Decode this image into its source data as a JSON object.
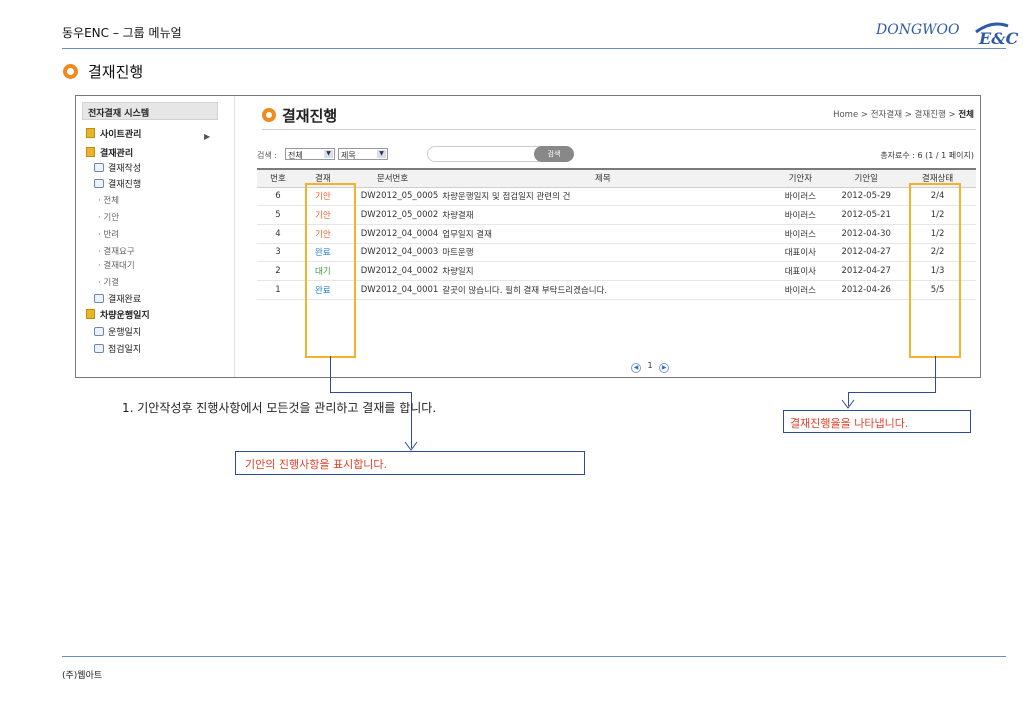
{
  "header": {
    "title": "동우ENC – 그룹 메뉴얼",
    "logo_main": "DONGWOO",
    "logo_sub": "E&C"
  },
  "section_title": "결재진행",
  "sidebar": {
    "head": "전자결재 시스템",
    "items": [
      {
        "label": "사이트관리"
      },
      {
        "label": "결재관리"
      },
      {
        "label": "결재작성"
      },
      {
        "label": "결재진행"
      },
      {
        "label": "· 전체"
      },
      {
        "label": "· 기안"
      },
      {
        "label": "· 반려"
      },
      {
        "label": "· 결재요구"
      },
      {
        "label": "· 결재대기"
      },
      {
        "label": "· 기결"
      },
      {
        "label": "결재완료"
      },
      {
        "label": "차량운행일지"
      },
      {
        "label": "운행일지"
      },
      {
        "label": "점검일지"
      }
    ]
  },
  "content": {
    "title": "결재진행",
    "breadcrumb": {
      "home": "Home",
      "a": "전자결재",
      "b": "결재진행",
      "c": "전체"
    },
    "search": {
      "label": "검색 :",
      "sel1": "전체",
      "sel2": "제목",
      "button": "검색"
    },
    "total": "총자료수 : 6 (1 / 1 페이지)",
    "columns": [
      "번호",
      "결재",
      "문서번호",
      "제목",
      "기안자",
      "기안일",
      "결재상태"
    ],
    "rows": [
      {
        "no": "6",
        "status": "기안",
        "doc": "DW2012_05_0005",
        "title": "차량운행일지 및 점검일지 관련의 건",
        "drafter": "바이러스",
        "date": "2012-05-29",
        "progress": "2/4"
      },
      {
        "no": "5",
        "status": "기안",
        "doc": "DW2012_05_0002",
        "title": "차량결재",
        "drafter": "바이러스",
        "date": "2012-05-21",
        "progress": "1/2"
      },
      {
        "no": "4",
        "status": "기안",
        "doc": "DW2012_04_0004",
        "title": "업무일지 결재",
        "drafter": "바이러스",
        "date": "2012-04-30",
        "progress": "1/2"
      },
      {
        "no": "3",
        "status": "완료",
        "doc": "DW2012_04_0003",
        "title": "마트운행",
        "drafter": "대표이사",
        "date": "2012-04-27",
        "progress": "2/2"
      },
      {
        "no": "2",
        "status": "대기",
        "doc": "DW2012_04_0002",
        "title": "차량일지",
        "drafter": "대표이사",
        "date": "2012-04-27",
        "progress": "1/3"
      },
      {
        "no": "1",
        "status": "완료",
        "doc": "DW2012_04_0001",
        "title": "갈곳이 많습니다. 필히 결재 부탁드리겠습니다.",
        "drafter": "바이러스",
        "date": "2012-04-26",
        "progress": "5/5"
      }
    ],
    "status_colors": {
      "기안": "#e8632a",
      "완료": "#2a7fd0",
      "대기": "#2f9a3c"
    },
    "pager": "1"
  },
  "annotations": {
    "note1": "1.  기안작성후  진행사항에서 모든것을 관리하고 결재를 합니다.",
    "box1": "기안의 진행사항을 표시합니다.",
    "box2": "결재진행율을 나타냅니다."
  },
  "footer": "(주)웹아트"
}
